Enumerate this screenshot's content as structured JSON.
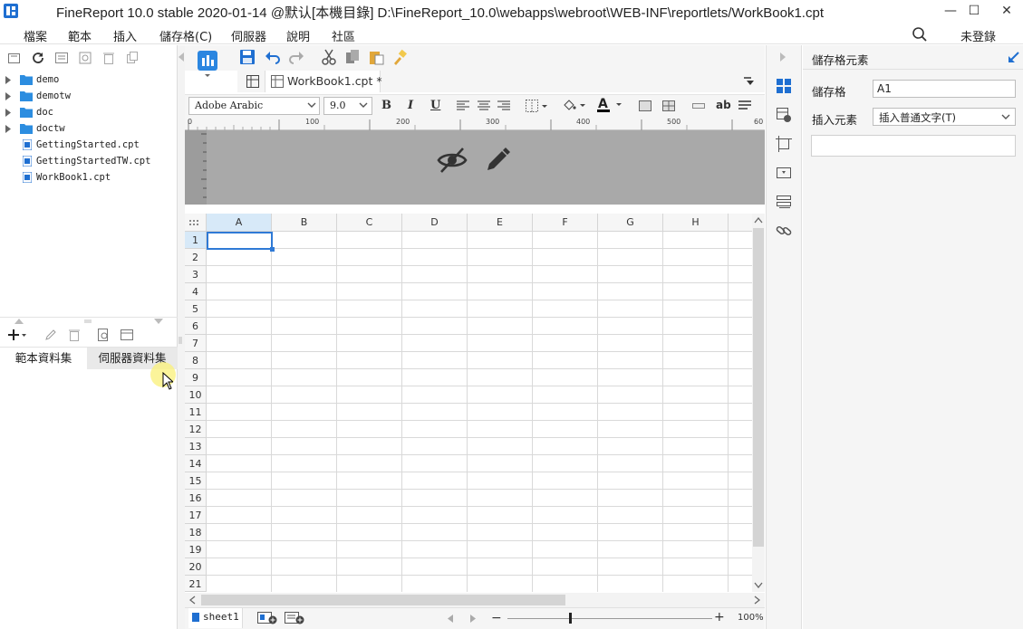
{
  "window": {
    "title": "FineReport 10.0 stable 2020-01-14 @默认[本機目錄]    D:\\FineReport_10.0\\webapps\\webroot\\WEB-INF\\reportlets/WorkBook1.cpt",
    "minimize": "—",
    "maximize": "☐",
    "close": "✕"
  },
  "menubar": {
    "items": [
      "檔案",
      "範本",
      "插入",
      "儲存格(C)",
      "伺服器",
      "說明",
      "社區"
    ],
    "login": "未登錄"
  },
  "file_tree": {
    "items": [
      {
        "label": "demo",
        "type": "folder"
      },
      {
        "label": "demotw",
        "type": "folder"
      },
      {
        "label": "doc",
        "type": "folder"
      },
      {
        "label": "doctw",
        "type": "folder"
      },
      {
        "label": "GettingStarted.cpt",
        "type": "file"
      },
      {
        "label": "GettingStartedTW.cpt",
        "type": "file"
      },
      {
        "label": "WorkBook1.cpt",
        "type": "file"
      }
    ]
  },
  "dataset_tabs": {
    "template": "範本資料集",
    "server": "伺服器資料集"
  },
  "editor_tab": {
    "label": "WorkBook1.cpt *"
  },
  "format_bar": {
    "font": "Adobe Arabic",
    "size": "9.0",
    "bold": "B",
    "italic": "I",
    "underline": "U",
    "ab": "ab"
  },
  "ruler": {
    "ticks": [
      "0",
      "100",
      "200",
      "300",
      "400",
      "500",
      "60"
    ]
  },
  "sheet": {
    "columns": [
      "A",
      "B",
      "C",
      "D",
      "E",
      "F",
      "G",
      "H"
    ],
    "rows": [
      "1",
      "2",
      "3",
      "4",
      "5",
      "6",
      "7",
      "8",
      "9",
      "10",
      "11",
      "12",
      "13",
      "14",
      "15",
      "16",
      "17",
      "18",
      "19",
      "20",
      "21"
    ],
    "selected_cell": "A1"
  },
  "status": {
    "sheet_tab": "sheet1",
    "zoom": "100%",
    "zoom_level": 1.0
  },
  "right_panel": {
    "title": "儲存格元素",
    "cell_label": "儲存格",
    "cell_value": "A1",
    "insert_label": "插入元素",
    "insert_value": "插入普通文字(T)"
  },
  "colors": {
    "accent": "#1f6fd1",
    "folder": "#2c8de0",
    "header_area": "#a9a9a9",
    "selected_header": "#d7e9f8"
  }
}
